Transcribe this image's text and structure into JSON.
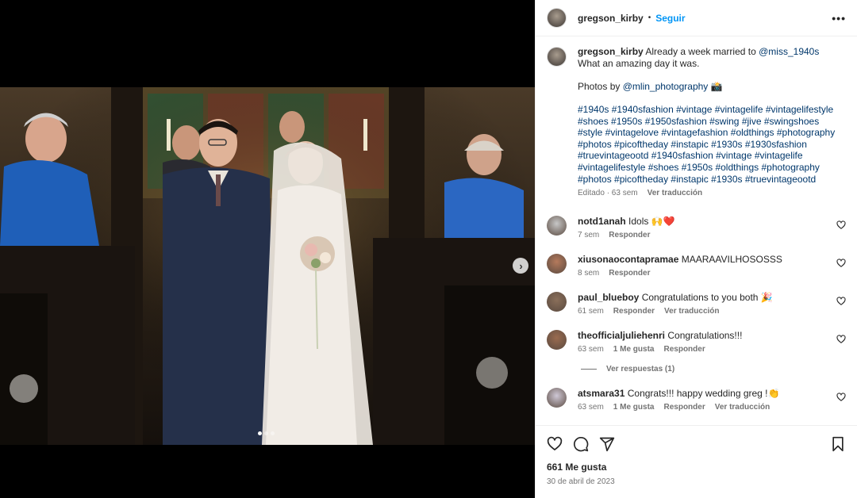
{
  "post": {
    "username": "gregson_kirby",
    "separator": "•",
    "follow_label": "Seguir",
    "more_label": "•••",
    "carousel_next": "›"
  },
  "caption": {
    "username": "gregson_kirby",
    "text1": "Already a week married to",
    "mention1": "@miss_1940s",
    "line2": "What an amazing day it was.",
    "photos_prefix": "Photos by",
    "mention2": "@mlin_photography",
    "camera_emoji": "📸",
    "hashtags": "#1940s #1940sfashion #vintage #vintagelife #vintagelifestyle #shoes #1950s #1950sfashion #swing #jive #swingshoes #style #vintagelove #vintagefashion #oldthings #photography #photos #picoftheday #instapic #1930s #1930sfashion #truevintageootd #1940sfashion #vintage #vintagelife #vintagelifestyle #shoes #1950s #oldthings #photography #photos #picoftheday #instapic #1930s #truevintageootd",
    "edited": "Editado · 63 sem",
    "translate": "Ver traducción"
  },
  "comments": [
    {
      "user": "notd1anah",
      "text": "Idols 🙌❤️",
      "time": "7 sem",
      "likes": "",
      "reply": "Responder",
      "translate": "",
      "avatar_color": "#c7c7c7"
    },
    {
      "user": "xiusonaocontapramae",
      "text": "MAARAAVILHOSOSSS",
      "time": "8 sem",
      "likes": "",
      "reply": "Responder",
      "translate": "",
      "avatar_color": "#b57a5c"
    },
    {
      "user": "paul_blueboy",
      "text": "Congratulations to you both 🎉",
      "time": "61 sem",
      "likes": "",
      "reply": "Responder",
      "translate": "Ver traducción",
      "avatar_color": "#8a6f5a"
    },
    {
      "user": "theofficialjuliehenri",
      "text": "Congratulations!!!",
      "time": "63 sem",
      "likes": "1 Me gusta",
      "reply": "Responder",
      "translate": "",
      "avatar_color": "#9a6b4f"
    },
    {
      "user": "atsmara31",
      "text": "Congrats!!! happy wedding greg !👏",
      "time": "63 sem",
      "likes": "1 Me gusta",
      "reply": "Responder",
      "translate": "Ver traducción",
      "avatar_color": "#cfc8d6"
    }
  ],
  "view_replies": "Ver respuestas (1)",
  "likes_count": "661 Me gusta",
  "post_date": "30 de abril de 2023",
  "carousel": {
    "count": 3,
    "active": 0
  },
  "colors": {
    "accent": "#0095f6",
    "link": "#00376b",
    "muted": "#737373"
  }
}
